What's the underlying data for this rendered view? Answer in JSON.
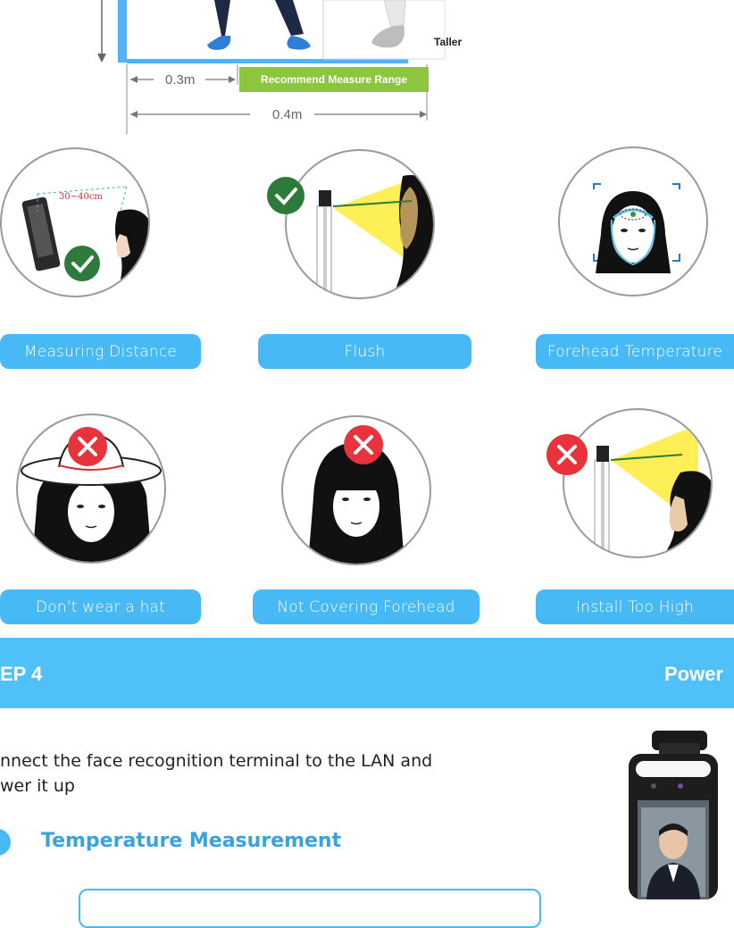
{
  "diagram": {
    "taller_label": "Taller",
    "dist_03": "0.3m",
    "dist_04": "0.4m",
    "recommend_label": "Recommend Measure Range"
  },
  "good_examples": [
    {
      "label": "Measuring Distance",
      "annotation": "30~40cm"
    },
    {
      "label": "Flush"
    },
    {
      "label": "Forehead Temperature"
    }
  ],
  "bad_examples": [
    {
      "label": "Don't wear a hat"
    },
    {
      "label": "Not Covering Forehead"
    },
    {
      "label": "Install Too High"
    }
  ],
  "step": {
    "number": "EP 4",
    "title": "Power"
  },
  "instruction": "nnect the face recognition terminal to the LAN and wer it up",
  "instruction_lines": [
    "nnect the face recognition terminal to the LAN and",
    "wer it up"
  ],
  "section_title": "Temperature Measurement",
  "colors": {
    "accent_blue": "#47b9f5",
    "step_blue": "#4fc0f8",
    "good_green": "#2d7a3a",
    "bad_red": "#e8323c",
    "range_green": "#8cc63f",
    "title_blue": "#3aa3dc"
  }
}
